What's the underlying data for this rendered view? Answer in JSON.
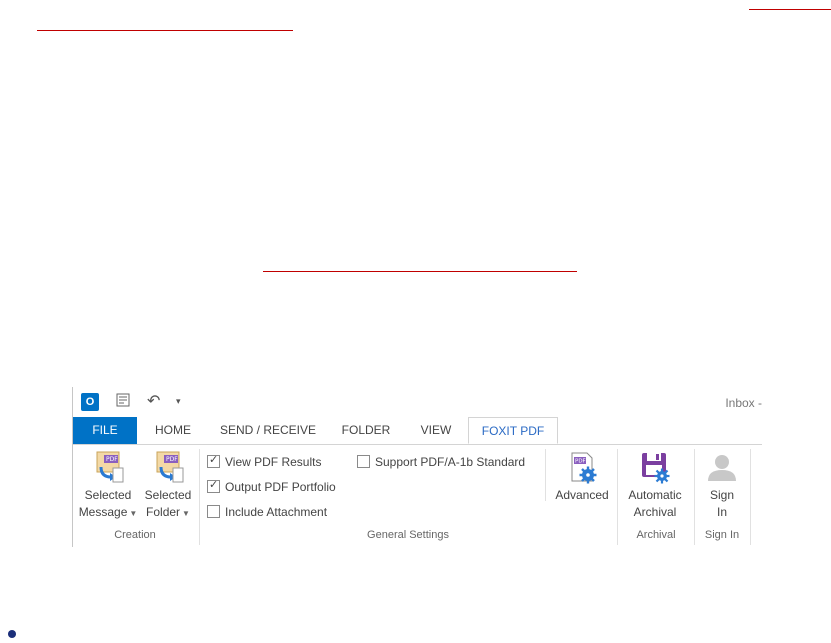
{
  "qat": {
    "outlook_icon": "O",
    "save_icon": "sync-icon",
    "undo_icon": "↶",
    "customize_icon": "▾",
    "window_title": "Inbox -"
  },
  "tabs": [
    {
      "label": "FILE"
    },
    {
      "label": "HOME"
    },
    {
      "label": "SEND / RECEIVE"
    },
    {
      "label": "FOLDER"
    },
    {
      "label": "VIEW"
    },
    {
      "label": "FOXIT PDF"
    }
  ],
  "groups": {
    "creation": {
      "label": "Creation",
      "selected_message": {
        "line1": "Selected",
        "line2": "Message"
      },
      "selected_folder": {
        "line1": "Selected",
        "line2": "Folder"
      }
    },
    "general_settings": {
      "label": "General Settings",
      "view_pdf_results": {
        "label": "View PDF Results",
        "checked": true
      },
      "output_pdf_portfolio": {
        "label": "Output PDF Portfolio",
        "checked": true
      },
      "include_attachment": {
        "label": "Include Attachment",
        "checked": false
      },
      "support_pdfa": {
        "label": "Support PDF/A-1b Standard",
        "checked": false
      },
      "advanced": {
        "label": "Advanced"
      }
    },
    "archival": {
      "label": "Archival",
      "automatic_archival": {
        "line1": "Automatic",
        "line2": "Archival"
      }
    },
    "sign_in": {
      "label": "Sign In",
      "button": {
        "line1": "Sign",
        "line2": "In"
      }
    }
  },
  "colors": {
    "accent": "#0072c6",
    "active_tab_text": "#2a6ac4",
    "link_red": "#c00000",
    "archival_purple": "#7b3fa0"
  }
}
